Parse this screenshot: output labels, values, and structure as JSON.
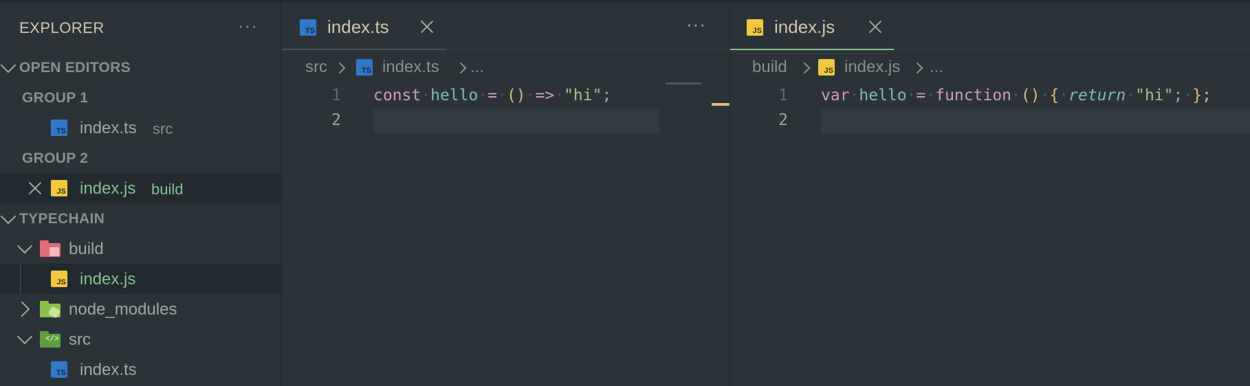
{
  "sidebar": {
    "title": "EXPLORER",
    "more": "···",
    "open_editors": {
      "label": "OPEN EDITORS",
      "groups": [
        {
          "label": "GROUP 1",
          "file": "index.ts",
          "dir": "src",
          "icon": "TS"
        },
        {
          "label": "GROUP 2",
          "file": "index.js",
          "dir": "build",
          "icon": "JS"
        }
      ]
    },
    "project": {
      "label": "TYPECHAIN",
      "build_folder": "build",
      "build_file": "index.js",
      "node_modules": "node_modules",
      "src_folder": "src",
      "src_file": "index.ts"
    }
  },
  "editor1": {
    "tab_label": "index.ts",
    "tab_icon": "TS",
    "more": "···",
    "breadcrumb": [
      "src",
      "index.ts",
      "..."
    ],
    "line_numbers": [
      "1",
      "2"
    ],
    "code": {
      "const": "const",
      "hello": "hello",
      "eq": "=",
      "parens": "()",
      "arrow": "=>",
      "str": "\"hi\"",
      "semi": ";"
    }
  },
  "editor2": {
    "tab_label": "index.js",
    "tab_icon": "JS",
    "breadcrumb": [
      "build",
      "index.js",
      "..."
    ],
    "line_numbers": [
      "1",
      "2"
    ],
    "code": {
      "var": "var",
      "hello": "hello",
      "eq": "=",
      "function": "function",
      "parens": "()",
      "lbrace": "{",
      "return": "return",
      "str": "\"hi\"",
      "semi": ";",
      "rbrace": "};"
    }
  },
  "colors": {
    "background": "#2b3339",
    "accent": "#83c092",
    "ts_icon": "#3178c6",
    "js_icon": "#f0c93e"
  }
}
